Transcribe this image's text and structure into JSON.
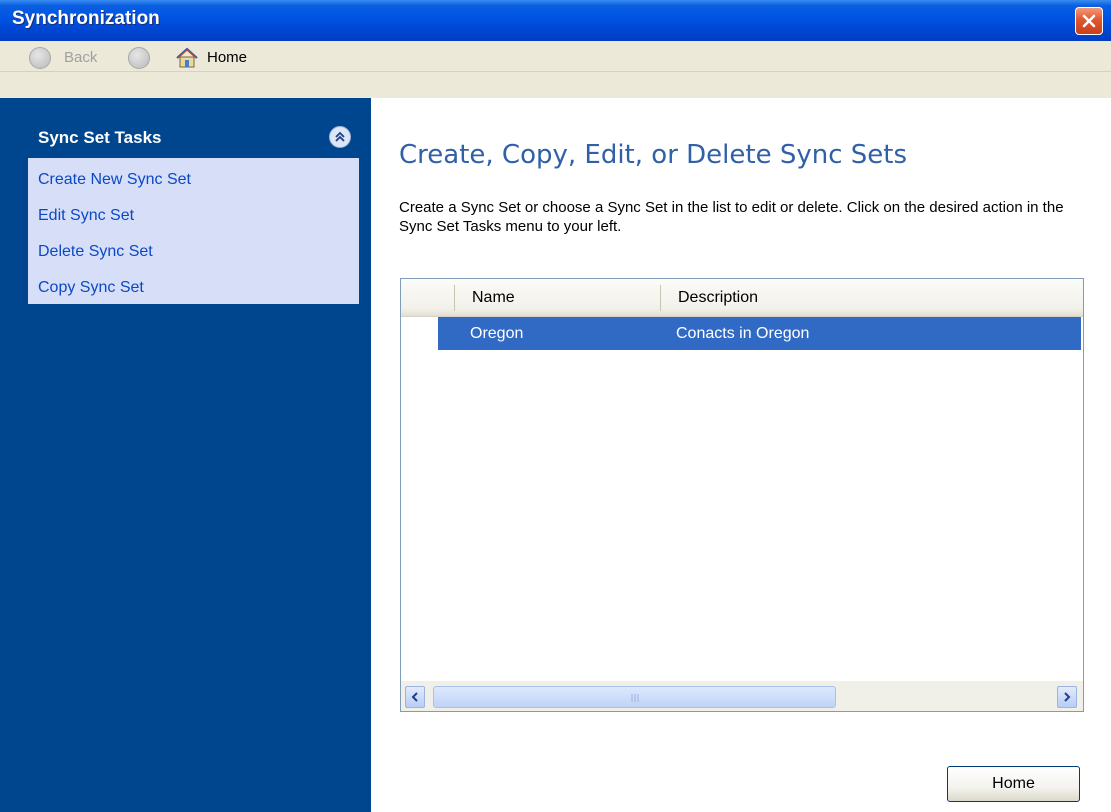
{
  "window": {
    "title": "Synchronization"
  },
  "navbar": {
    "back_label": "Back",
    "home_label": "Home"
  },
  "sidebar": {
    "panel_title": "Sync Set Tasks",
    "tasks": [
      {
        "label": "Create New Sync Set"
      },
      {
        "label": "Edit Sync Set"
      },
      {
        "label": "Delete Sync Set"
      },
      {
        "label": "Copy Sync Set"
      }
    ]
  },
  "main": {
    "heading": "Create, Copy, Edit, or Delete Sync Sets",
    "description": "Create a Sync Set or choose a Sync Set in the list to edit or delete. Click on the desired action in the Sync Set Tasks menu to your left.",
    "list": {
      "columns": [
        "Name",
        "Description"
      ],
      "rows": [
        {
          "name": "Oregon",
          "description": "Conacts in Oregon"
        }
      ]
    },
    "home_button_label": "Home"
  },
  "colors": {
    "titlebar": "#0055e5",
    "sidebar": "#00468e",
    "selection": "#316ac5",
    "heading": "#3060a8"
  }
}
